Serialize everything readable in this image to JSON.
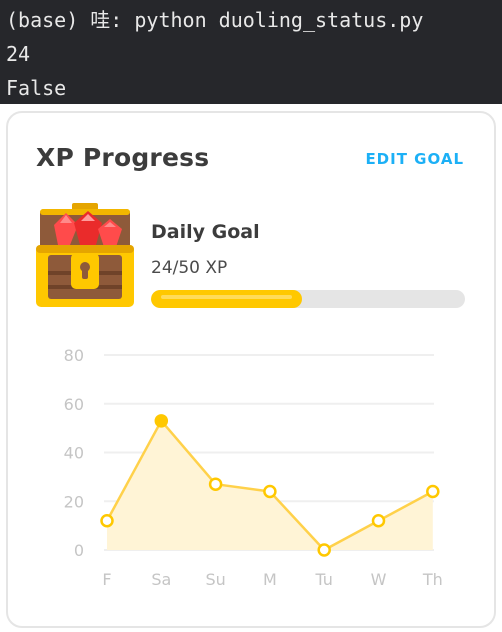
{
  "terminal": {
    "lines": [
      "(base) 哇: python duoling_status.py",
      "24",
      "False"
    ]
  },
  "card": {
    "title": "XP Progress",
    "edit_label": "EDIT GOAL"
  },
  "goal": {
    "label": "Daily Goal",
    "value_text": "24/50 XP",
    "progress_fraction": 0.48
  },
  "colors": {
    "accent_blue": "#1cb0f6",
    "gold": "#ffc800",
    "line": "#ffd14a"
  },
  "chart_data": {
    "type": "area",
    "categories": [
      "F",
      "Sa",
      "Su",
      "M",
      "Tu",
      "W",
      "Th"
    ],
    "values": [
      12,
      53,
      27,
      24,
      0,
      12,
      24
    ],
    "highlight_index": 1,
    "yticks": [
      0,
      20,
      40,
      60,
      80
    ],
    "ylim": [
      0,
      80
    ],
    "grid": true
  }
}
